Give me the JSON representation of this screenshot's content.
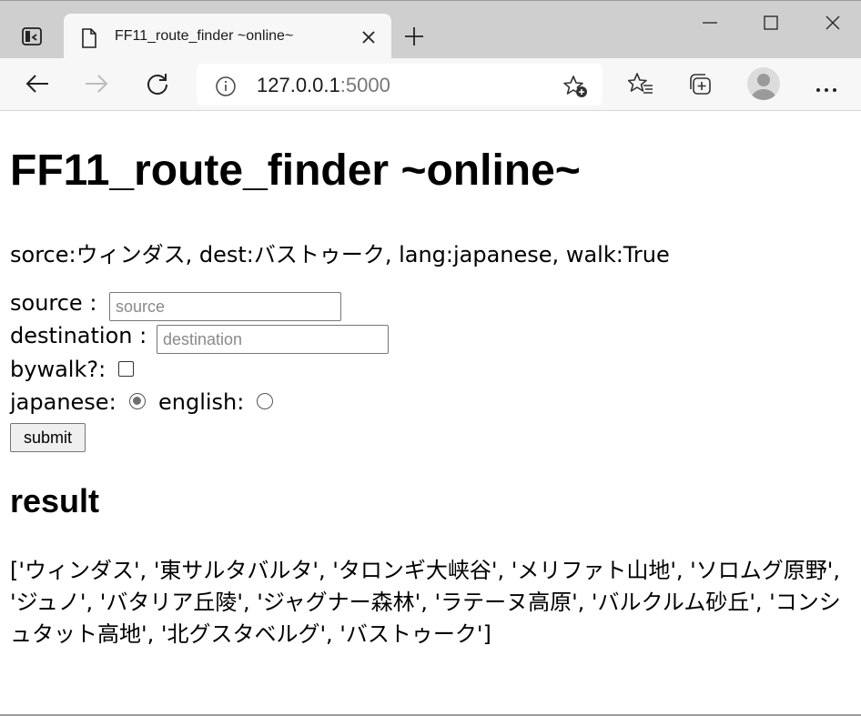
{
  "browser": {
    "tab_title": "FF11_route_finder ~online~",
    "url_host": "127.0.0.1",
    "url_port": ":5000"
  },
  "icons": {
    "tab_actions": "tab-actions-icon",
    "tab_page": "document-icon",
    "tab_close": "close-icon",
    "new_tab": "plus-icon",
    "minimize": "minimize-icon",
    "maximize": "maximize-icon",
    "close_window": "close-icon",
    "back": "arrow-left-icon",
    "forward": "arrow-right-icon",
    "refresh": "refresh-icon",
    "site_info": "info-icon",
    "add_favorite": "star-plus-icon",
    "favorites": "favorites-list-icon",
    "collections": "collections-icon",
    "profile": "profile-avatar",
    "more": "more-icon"
  },
  "page": {
    "title": "FF11_route_finder ~online~",
    "status": "sorce:ウィンダス, dest:バストゥーク, lang:japanese, walk:True",
    "form": {
      "source_label": "source :",
      "source_placeholder": "source",
      "source_value": "",
      "destination_label": "destination :",
      "destination_placeholder": "destination",
      "destination_value": "",
      "bywalk_label": "bywalk?:",
      "bywalk_checked": false,
      "japanese_label": "japanese:",
      "japanese_checked": true,
      "english_label": "english:",
      "english_checked": false,
      "submit_label": "submit"
    },
    "result_heading": "result",
    "result_text": "['ウィンダス', '東サルタバルタ', 'タロンギ大峡谷', 'メリファト山地', 'ソロムグ原野', 'ジュノ', 'バタリア丘陵', 'ジャグナー森林', 'ラテーヌ高原', 'バルクルム砂丘', 'コンシュタット高地', '北グスタベルグ', 'バストゥーク']"
  },
  "colors": {
    "titlebar_bg": "#cfcfcf",
    "toolbar_bg": "#f7f7f7",
    "page_bg": "#ffffff"
  }
}
